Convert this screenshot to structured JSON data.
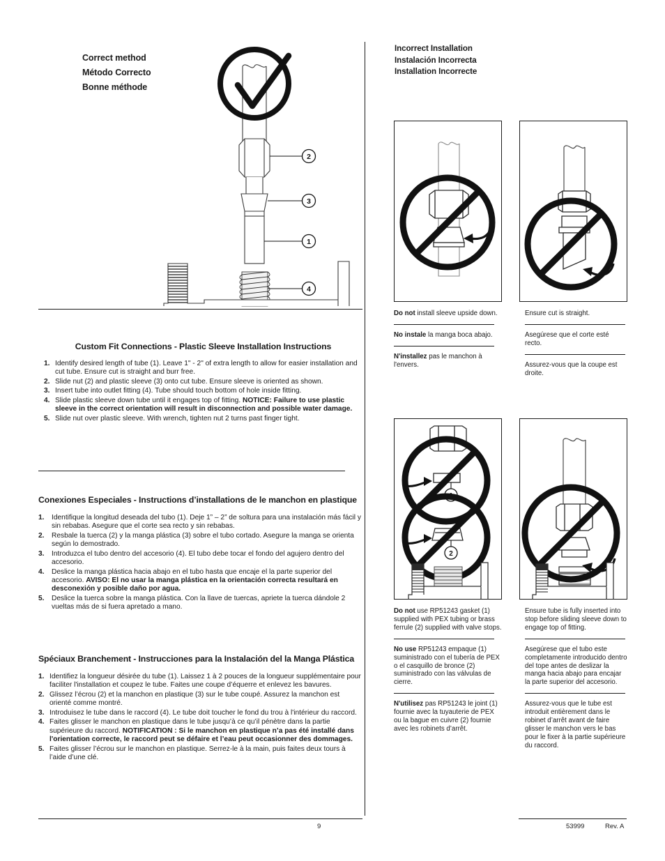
{
  "left_column": {
    "correct_heading": {
      "en": "Correct method",
      "es": "Método Correcto",
      "fr": "Bonne méthode"
    },
    "diagram": {
      "name": "correct-assembly-exploded-diagram",
      "callouts": [
        {
          "number": "1",
          "part": "tube"
        },
        {
          "number": "2",
          "part": "nut"
        },
        {
          "number": "3",
          "part": "plastic-sleeve"
        },
        {
          "number": "4",
          "part": "outlet-fitting"
        }
      ],
      "check_icon": "check-mark-circle-icon"
    },
    "english": {
      "title": "Custom Fit Connections - Plastic Sleeve Installation Instructions",
      "steps": [
        {
          "num": "1.",
          "text": "Identify desired length of tube (1). Leave 1\" - 2\" of extra length to allow for easier installation and cut tube. Ensure cut is straight and burr free.",
          "bold_text": ""
        },
        {
          "num": "2.",
          "text": "Slide nut (2) and plastic sleeve (3) onto cut tube. Ensure sleeve is oriented as shown.",
          "bold_text": ""
        },
        {
          "num": "3.",
          "text": "Insert tube into outlet fitting (4). Tube should touch bottom of hole inside fitting.",
          "bold_text": ""
        },
        {
          "num": "4.",
          "text": "Slide plastic sleeve down tube until it engages top of fitting. ",
          "bold_text": "NOTICE: Failure to use plastic sleeve in the correct orientation will result in disconnection and possible water damage."
        },
        {
          "num": "5.",
          "text": "Slide nut over plastic sleeve. With wrench, tighten nut 2 turns past finger tight.",
          "bold_text": ""
        }
      ]
    },
    "spanish": {
      "title": "Conexiones Especiales - Instructions d’installations de le manchon en plastique",
      "steps": [
        {
          "num": "1.",
          "text": "Identifique la longitud deseada del tubo (1). Deje 1” – 2” de soltura para una instalación más fácil y sin rebabas. Asegure que el corte sea recto y sin rebabas.",
          "bold_text": ""
        },
        {
          "num": "2.",
          "text": "Resbale la tuerca (2) y la manga plástica (3) sobre el tubo cortado. Asegure la manga se orienta según lo demostrado.",
          "bold_text": ""
        },
        {
          "num": "3.",
          "text": "Introduzca el tubo dentro del accesorio (4). El tubo debe tocar el fondo del agujero dentro del accesorio.",
          "bold_text": ""
        },
        {
          "num": "4.",
          "text": "Deslice la manga plástica hacia abajo en el tubo hasta que encaje el la parte superior del accesorio. ",
          "bold_text": "AVISO: El no usar la manga plástica en la orientación correcta resultará en desconexión y posible daño por agua."
        },
        {
          "num": "5.",
          "text": "Deslice la tuerca sobre la manga plástica. Con la llave de tuercas, apriete la tuerca dándole 2 vueltas más de si fuera apretado a mano.",
          "bold_text": ""
        }
      ]
    },
    "french": {
      "title": "Spéciaux Branchement - Instrucciones para la Instalación del la Manga Plástica",
      "steps": [
        {
          "num": "1.",
          "text": "Identifiez la longueur désirée du tube (1). Laissez 1 à 2 pouces de la longueur supplémentaire pour faciliter l'installation et coupez le tube. Faites une coupe d’équerre et enlevez les bavures.",
          "bold_text": ""
        },
        {
          "num": "2.",
          "text": "Glissez l’écrou (2) et la manchon en plastique (3) sur le tube coupé. Assurez la manchon est orienté comme montré.",
          "bold_text": ""
        },
        {
          "num": "3.",
          "text": "Introduisez le tube dans le raccord (4). Le tube doit toucher le fond du trou à l'intérieur du raccord.",
          "bold_text": ""
        },
        {
          "num": "4.",
          "text": "Faites glisser le manchon en plastique dans le tube jusqu’à ce qu’il pénètre dans la partie supérieure du raccord. ",
          "bold_text": "NOTIFICATION : Si le manchon en plastique n’a pas été installé dans l'orientation correcte, le raccord peut se défaire et l’eau peut occasionner des dommages."
        },
        {
          "num": "5.",
          "text": "Faites glisser l’écrou sur le manchon en plastique. Serrez-le à la main, puis faites deux tours à l’aide d’une clé.",
          "bold_text": ""
        }
      ]
    }
  },
  "right_column": {
    "incorrect_heading": {
      "en": "Incorrect Installation",
      "es": "Instalación Incorrecta",
      "fr": "Installation Incorrecte"
    },
    "panels": [
      {
        "id": "sleeve-upside-down",
        "figure": "prohibition-sleeve-inverted",
        "captions": {
          "en_bold": "Do not",
          "en_rest": " install sleeve upside down.",
          "es_bold": "No instale",
          "es_rest": " la manga boca abajo.",
          "fr_bold": "N'installez",
          "fr_rest": " pas le manchon à l'envers."
        }
      },
      {
        "id": "angled-cut",
        "figure": "prohibition-angled-cut",
        "captions": {
          "en_bold": "",
          "en_rest": "Ensure cut is straight.",
          "es_bold": "",
          "es_rest": "Asegúrese que el corte esté recto.",
          "fr_bold": "",
          "fr_rest": "Assurez-vous que la coupe est droite."
        }
      },
      {
        "id": "wrong-gasket-ferrule",
        "figure": "prohibition-gasket-ferrule",
        "callouts": [
          {
            "number": "1",
            "part": "rp51243-gasket"
          },
          {
            "number": "2",
            "part": "brass-ferrule"
          }
        ],
        "captions": {
          "en_bold": "Do not",
          "en_rest": " use RP51243 gasket (1) supplied with PEX tubing or brass ferrule (2) supplied with valve stops.",
          "es_bold": "No use",
          "es_rest": " RP51243 empaque (1) suministrado con el tubería de PEX o el casquillo de bronce (2) suministrado con las válvulas de cierre.",
          "fr_bold": "N'utilisez",
          "fr_rest": " pas RP51243 le joint (1) fournie avec la tuyauterie de PEX ou la bague en cuivre (2) fournie avec les robinets d’arrêt."
        }
      },
      {
        "id": "tube-not-inserted",
        "figure": "prohibition-tube-not-seated",
        "captions": {
          "en_bold": "",
          "en_rest": "Ensure tube is fully inserted into stop before sliding sleeve down to engage top of fitting.",
          "es_bold": "",
          "es_rest": "Asegúrese que el tubo este completamente introducido dentro del tope antes de deslizar la manga hacia abajo para encajar la parte superior del accesorio.",
          "fr_bold": "",
          "fr_rest": "Assurez-vous que le tube est introduit entièrement dans le robinet d’arrêt avant de faire glisser le manchon vers le bas pour le fixer à la partie supérieure du raccord."
        }
      }
    ]
  },
  "footer": {
    "page_number": "9",
    "doc_code": "53999",
    "revision": "Rev. A"
  }
}
